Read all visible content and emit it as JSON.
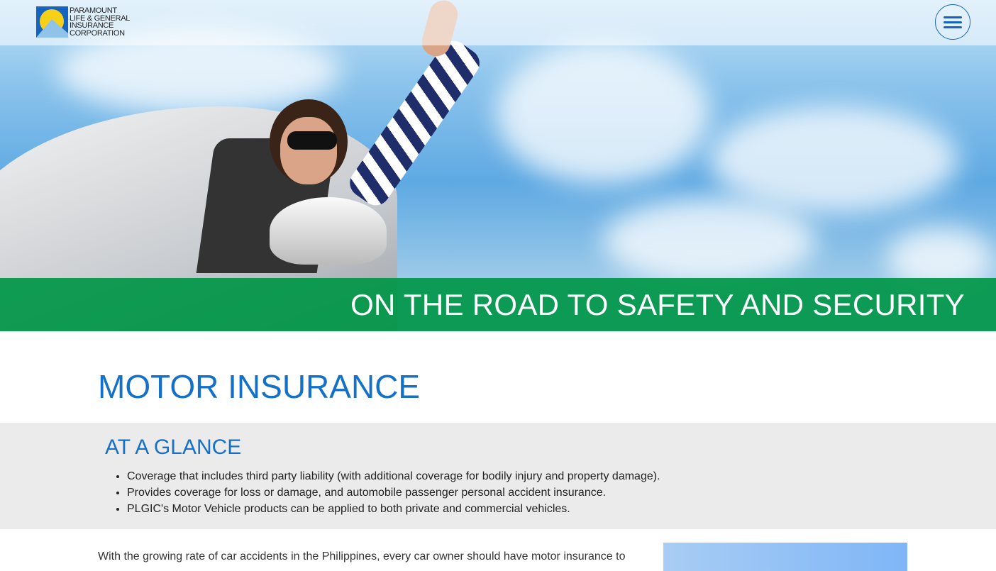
{
  "header": {
    "logo_text": [
      "PARAMOUNT",
      "LIFE & GENERAL",
      "INSURANCE",
      "CORPORATION"
    ],
    "menu_icon": "hamburger-icon"
  },
  "hero": {
    "tagline": "ON THE ROAD TO SAFETY AND SECURITY"
  },
  "page": {
    "title": "MOTOR INSURANCE"
  },
  "glance": {
    "heading": "AT A GLANCE",
    "items": [
      "Coverage that includes third party liability (with additional coverage for bodily injury and property damage).",
      "Provides coverage for loss or damage, and automobile passenger personal accident insurance.",
      "PLGIC's Motor Vehicle products can be applied to both private and commercial vehicles."
    ]
  },
  "body": {
    "intro": "With the growing rate of car accidents in the Philippines, every car owner should have motor insurance to"
  },
  "colors": {
    "accent": "#1570c8",
    "banner": "#009646"
  }
}
